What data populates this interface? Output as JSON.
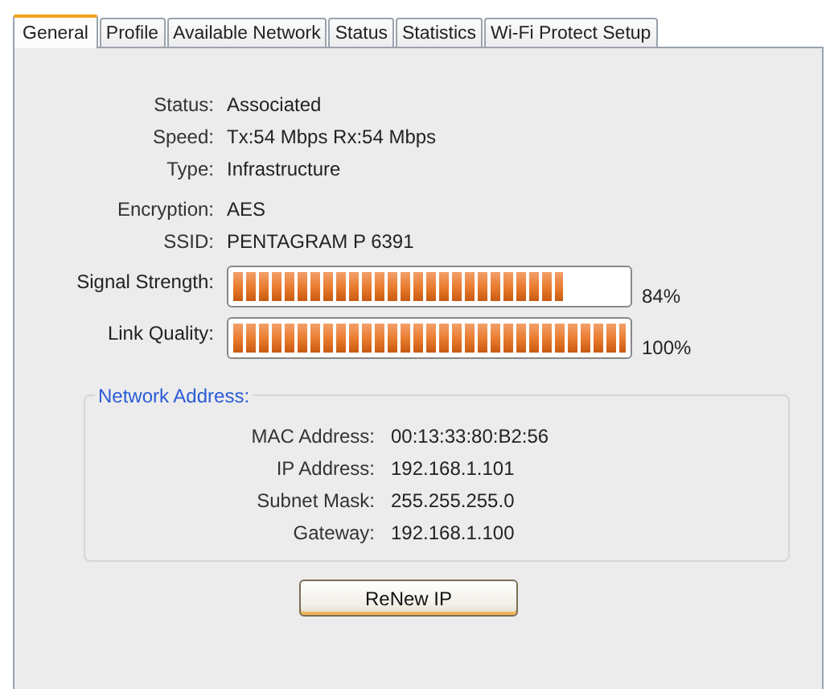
{
  "tabs": [
    {
      "label": "General",
      "selected": true
    },
    {
      "label": "Profile",
      "selected": false
    },
    {
      "label": "Available Network",
      "selected": false
    },
    {
      "label": "Status",
      "selected": false
    },
    {
      "label": "Statistics",
      "selected": false
    },
    {
      "label": "Wi-Fi Protect Setup",
      "selected": false
    }
  ],
  "info": [
    {
      "label": "Status:",
      "value": "Associated"
    },
    {
      "label": "Speed:",
      "value": "Tx:54 Mbps Rx:54 Mbps"
    },
    {
      "label": "Type:",
      "value": "Infrastructure"
    },
    {
      "label": "Encryption:",
      "value": "AES"
    },
    {
      "label": "SSID:",
      "value": "PENTAGRAM P 6391"
    }
  ],
  "meters": [
    {
      "label": "Signal Strength:",
      "level": 0.84,
      "reading": "84%"
    },
    {
      "label": "Link Quality:",
      "level": 1.0,
      "reading": "100%"
    }
  ],
  "network_address": {
    "title": "Network Address:",
    "rows": [
      {
        "label": "MAC Address:",
        "value": "00:13:33:80:B2:56"
      },
      {
        "label": "IP Address:",
        "value": "192.168.1.101"
      },
      {
        "label": "Subnet Mask:",
        "value": "255.255.255.0"
      },
      {
        "label": "Gateway:",
        "value": "192.168.1.100"
      }
    ]
  },
  "button": "ReNew IP"
}
